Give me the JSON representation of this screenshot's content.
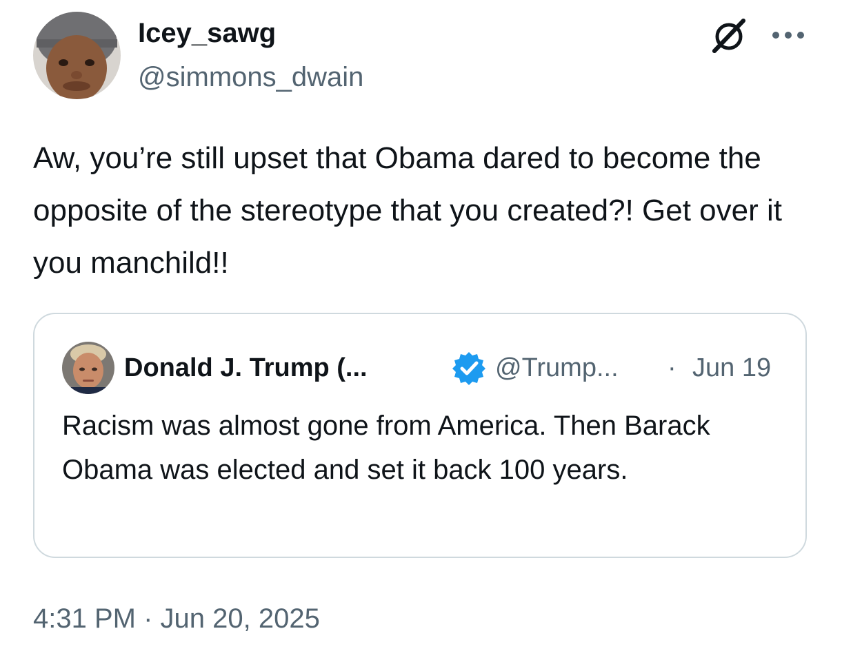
{
  "author": {
    "display_name": "Icey_sawg",
    "handle": "@simmons_dwain"
  },
  "actions": {
    "grok_icon": "grok-icon",
    "more_icon": "more-horizontal-icon"
  },
  "tweet": {
    "text": "Aw, you’re still upset that Obama dared to become the opposite of the stereotype that you created?! Get over it you manchild!!",
    "time": "4:31 PM",
    "separator": "·",
    "date": "Jun 20, 2025"
  },
  "quote": {
    "display_name": "Donald J. Trump (...",
    "verified_icon": "verified-badge-icon",
    "verified_color": "#1d9bf0",
    "handle": "@Trump...",
    "separator": "·",
    "date": "Jun 19",
    "text": "Racism was almost gone from America. Then Barack Obama was elected and set it back 100 years."
  },
  "colors": {
    "text_primary": "#0f1419",
    "text_secondary": "#536471",
    "border": "#cfd9de"
  }
}
